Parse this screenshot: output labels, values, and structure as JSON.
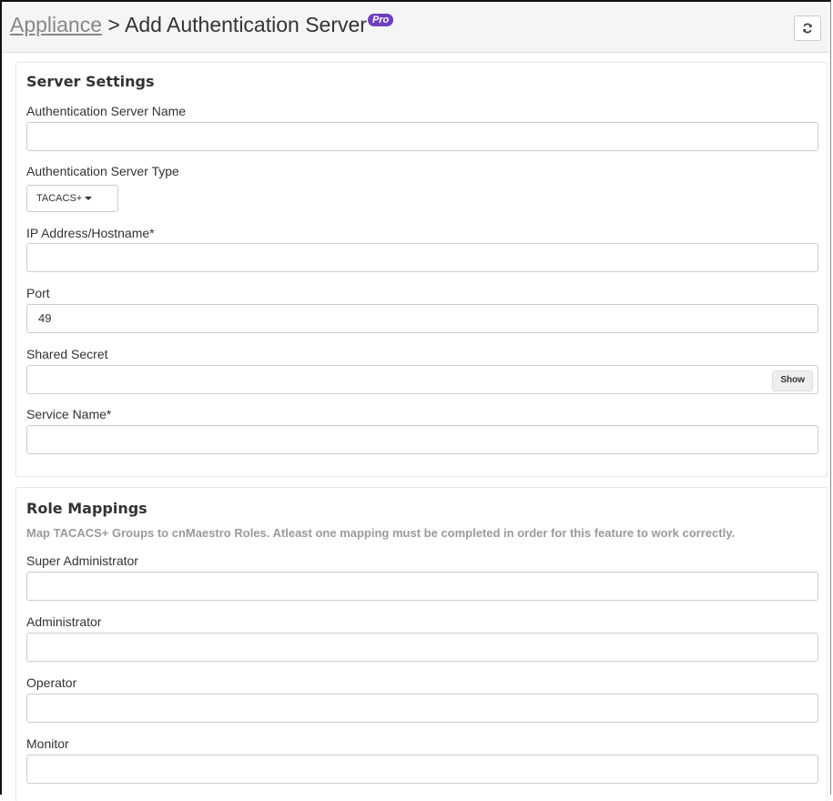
{
  "header": {
    "breadcrumb_link": "Appliance",
    "separator": " > ",
    "title": "Add Authentication Server",
    "pro_badge": "Pro",
    "refresh_icon": "refresh-icon"
  },
  "server_settings": {
    "heading": "Server Settings",
    "server_name": {
      "label": "Authentication Server Name",
      "value": ""
    },
    "server_type": {
      "label": "Authentication Server Type",
      "selected": "TACACS+"
    },
    "ip_address": {
      "label": "IP Address/Hostname*",
      "value": ""
    },
    "port": {
      "label": "Port",
      "value": "49"
    },
    "shared_secret": {
      "label": "Shared Secret",
      "value": "",
      "show_label": "Show"
    },
    "service_name": {
      "label": "Service Name*",
      "value": ""
    }
  },
  "role_mappings": {
    "heading": "Role Mappings",
    "hint": "Map TACACS+ Groups to cnMaestro Roles. Atleast one mapping must be completed in order for this feature to work correctly.",
    "super_admin": {
      "label": "Super Administrator",
      "value": ""
    },
    "admin": {
      "label": "Administrator",
      "value": ""
    },
    "operator": {
      "label": "Operator",
      "value": ""
    },
    "monitor": {
      "label": "Monitor",
      "value": ""
    }
  }
}
